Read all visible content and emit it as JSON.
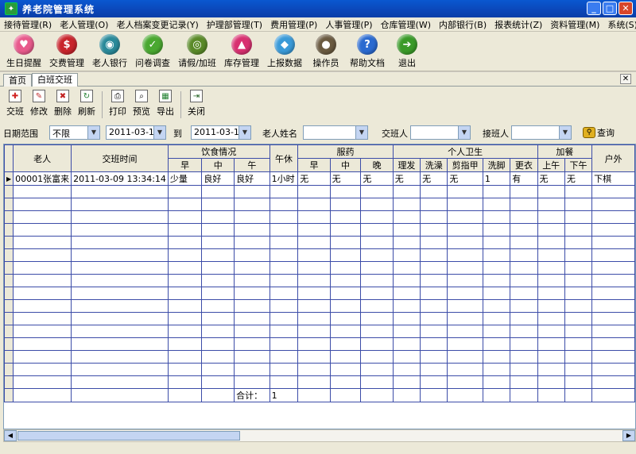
{
  "window": {
    "title": "养老院管理系统"
  },
  "menu": [
    "接待管理(R)",
    "老人管理(O)",
    "老人档案变更记录(Y)",
    "护理部管理(T)",
    "费用管理(P)",
    "人事管理(P)",
    "仓库管理(W)",
    "内部银行(B)",
    "报表统计(Z)",
    "资料管理(M)",
    "系统(S)",
    "帮"
  ],
  "bigtoolbar": [
    {
      "label": "生日提醒",
      "icon": "birthday-icon",
      "color": "#e85a8c"
    },
    {
      "label": "交费管理",
      "icon": "dollar-icon",
      "color": "#c8242c"
    },
    {
      "label": "老人银行",
      "icon": "bank-icon",
      "color": "#2a8a9a"
    },
    {
      "label": "问卷调查",
      "icon": "check-icon",
      "color": "#4aa830"
    },
    {
      "label": "请假/加班",
      "icon": "leave-icon",
      "color": "#5a8a28"
    },
    {
      "label": "库存管理",
      "icon": "stock-up-icon",
      "color": "#d83070"
    },
    {
      "label": "上报数据",
      "icon": "report-icon",
      "color": "#3a9ad8"
    },
    {
      "label": "操作员",
      "icon": "operator-icon",
      "color": "#6a5a40"
    },
    {
      "label": "帮助文档",
      "icon": "help-icon",
      "color": "#2a6ad0"
    },
    {
      "label": "退出",
      "icon": "exit-icon",
      "color": "#3a9a28"
    }
  ],
  "tabs": [
    {
      "label": "首页"
    },
    {
      "label": "白班交班"
    }
  ],
  "tools": [
    {
      "label": "交班",
      "icon": "add-icon"
    },
    {
      "label": "修改",
      "icon": "edit-icon"
    },
    {
      "label": "删除",
      "icon": "delete-icon"
    },
    {
      "label": "刷新",
      "icon": "refresh-icon"
    },
    {
      "label": "打印",
      "icon": "print-icon"
    },
    {
      "label": "预览",
      "icon": "preview-icon"
    },
    {
      "label": "导出",
      "icon": "export-icon"
    },
    {
      "label": "关闭",
      "icon": "close-door-icon"
    }
  ],
  "filters": {
    "date_range_label": "日期范围",
    "date_range_value": "不限",
    "date_from": "2011-03-17",
    "to_label": "到",
    "date_to": "2011-03-17",
    "elder_name_label": "老人姓名",
    "handover_label": "交班人",
    "receiver_label": "接班人",
    "query_label": "查询"
  },
  "grid": {
    "header_top": {
      "elder": "老人",
      "time": "交班时间",
      "diet": "饮食情况",
      "nap": "午休",
      "medicine": "服药",
      "hygiene": "个人卫生",
      "extra_meal": "加餐",
      "outdoor": "户外"
    },
    "header_sub": {
      "diet": [
        "早",
        "中",
        "午"
      ],
      "medicine": [
        "早",
        "中",
        "晚"
      ],
      "hygiene": [
        "理发",
        "洗澡",
        "剪指甲",
        "洗脚",
        "更衣"
      ],
      "extra_meal": [
        "上午",
        "下午"
      ]
    },
    "rows": [
      [
        "00001张富来",
        "2011-03-09 13:34:14",
        "少量",
        "良好",
        "良好",
        "1小时",
        "无",
        "无",
        "无",
        "无",
        "无",
        "无",
        "1",
        "有",
        "无",
        "无",
        "下棋"
      ]
    ],
    "footer": {
      "total_label": "合计：",
      "total_value": "1"
    }
  }
}
